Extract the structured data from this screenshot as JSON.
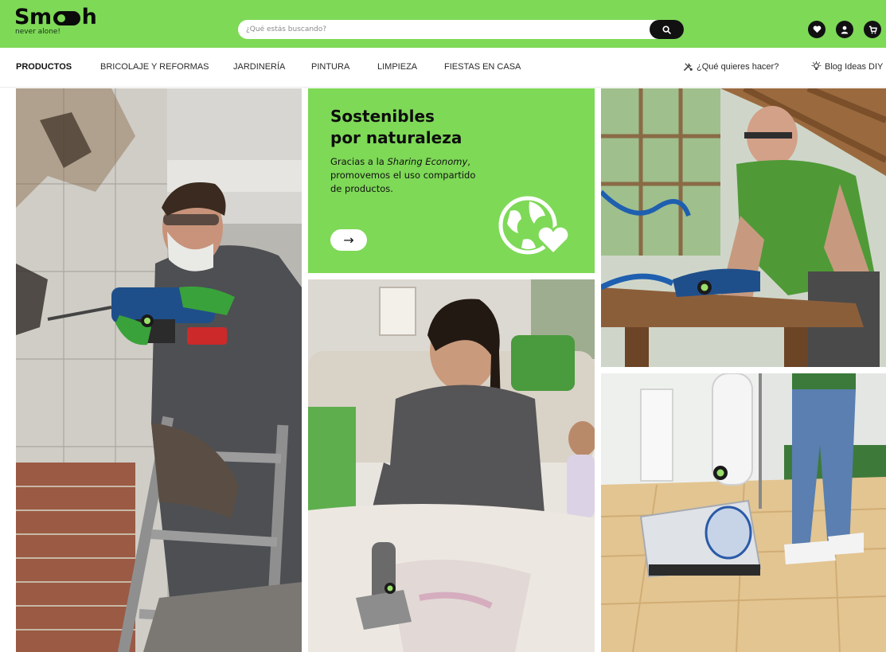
{
  "brand": {
    "logo_prefix": "Sm",
    "logo_suffix": "h",
    "tagline": "never alone!"
  },
  "search": {
    "placeholder": "¿Qué estás buscando?"
  },
  "header_icons": [
    "heart-icon",
    "user-icon",
    "cart-icon"
  ],
  "nav": {
    "items": [
      {
        "label": "PRODUCTOS",
        "active": true
      },
      {
        "label": "BRICOLAJE Y REFORMAS"
      },
      {
        "label": "JARDINERÍA"
      },
      {
        "label": "PINTURA"
      },
      {
        "label": "LIMPIEZA"
      },
      {
        "label": "FIESTAS EN CASA"
      }
    ],
    "what_to_do": "¿Qué quieres hacer?",
    "blog": "Blog Ideas DIY"
  },
  "promo": {
    "title_line1": "Sostenibles",
    "title_line2": "por naturaleza",
    "body_pre": "Gracias a la ",
    "body_em": "Sharing Economy",
    "body_post": ", promovemos el uso compartido de productos.",
    "arrow": "→"
  },
  "colors": {
    "brand_green": "#7ed957",
    "dark": "#111111",
    "white": "#ffffff"
  }
}
